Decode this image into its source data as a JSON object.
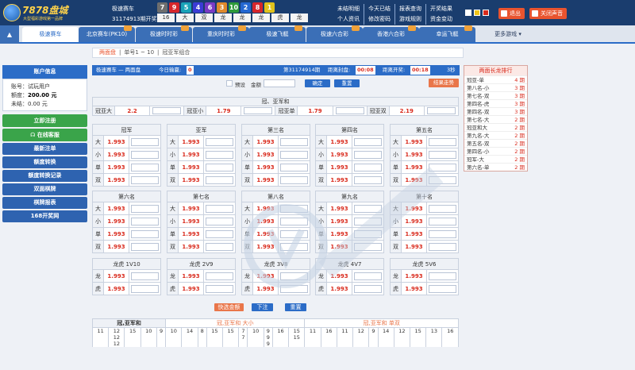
{
  "header": {
    "logo_name": "7878盘城",
    "logo_sub": "大型福彩游戏第一品牌",
    "game_name": "极速赛车",
    "period_text": "31174913期开奖",
    "balls": [
      {
        "n": "7",
        "c": "#6e6e6e"
      },
      {
        "n": "9",
        "c": "#d6262b"
      },
      {
        "n": "5",
        "c": "#1aa3b8"
      },
      {
        "n": "4",
        "c": "#3b3bd6"
      },
      {
        "n": "6",
        "c": "#7a3ac4"
      },
      {
        "n": "3",
        "c": "#e08a2c"
      },
      {
        "n": "10",
        "c": "#2e9a3a"
      },
      {
        "n": "2",
        "c": "#2468d2"
      },
      {
        "n": "8",
        "c": "#d6262b"
      },
      {
        "n": "1",
        "c": "#e0c21c"
      }
    ],
    "lhd": [
      "16",
      "大",
      "双",
      "龙",
      "龙",
      "龙",
      "虎",
      "龙"
    ],
    "links_row1": [
      "未结明细",
      "今天已结",
      "报表查询",
      "开奖结果"
    ],
    "links_row2": [
      "个人资讯",
      "修改密码",
      "游戏规则",
      "资金变动"
    ],
    "color_swatches": [
      "#ffffff",
      "#f0c419",
      "#d92a1c"
    ],
    "logout": "退出",
    "sound": "关闭声音"
  },
  "nav": {
    "tabs": [
      "极速赛车",
      "北京赛车(PK10)",
      "极速时时彩",
      "重庆时时彩",
      "极速飞艇",
      "极速六合彩",
      "香港六合彩",
      "幸运飞艇"
    ],
    "more": "更多游戏"
  },
  "sidebar": {
    "title": "账户信息",
    "account_label": "账号：",
    "account_value": "试玩用户",
    "credit_label": "额度：",
    "credit_value": "200.00 元",
    "unsettled_label": "未结：",
    "unsettled_value": "0.00 元",
    "register": "立即注册",
    "service": "在线客服",
    "menu": [
      "最新注单",
      "额度转换",
      "额度转换记录",
      "双面棋牌",
      "棋牌报表",
      "168开奖网"
    ]
  },
  "crumbs": {
    "active": "两面盘",
    "items": [
      "单号1 ~ 10",
      "冠亚军组合"
    ]
  },
  "bar": {
    "title": "极速赛车 — 两面盘",
    "profit_label": "今日输赢:",
    "profit_value": "0",
    "period": "第31174914期",
    "close_label": "距离封盘:",
    "close_time": "00:08",
    "draw_label": "距离开奖:",
    "draw_time": "00:18",
    "count": "3秒"
  },
  "tools": {
    "preset": "预设",
    "amount_label": "金额",
    "confirm": "确定",
    "reset": "重置",
    "trend": "结果走势"
  },
  "guan_ya": {
    "title": "冠、亚军和",
    "cells": [
      {
        "k": "冠亚大",
        "o": "2.2"
      },
      {
        "k": "冠亚小",
        "o": "1.79"
      },
      {
        "k": "冠亚单",
        "o": "1.79"
      },
      {
        "k": "冠亚双",
        "o": "2.19"
      }
    ]
  },
  "groups": [
    {
      "title": "冠军",
      "rows": [
        [
          "大",
          "1.993"
        ],
        [
          "小",
          "1.993"
        ],
        [
          "单",
          "1.993"
        ],
        [
          "双",
          "1.993"
        ]
      ]
    },
    {
      "title": "亚军",
      "rows": [
        [
          "大",
          "1.993"
        ],
        [
          "小",
          "1.993"
        ],
        [
          "单",
          "1.993"
        ],
        [
          "双",
          "1.993"
        ]
      ]
    },
    {
      "title": "第三名",
      "rows": [
        [
          "大",
          "1.993"
        ],
        [
          "小",
          "1.993"
        ],
        [
          "单",
          "1.993"
        ],
        [
          "双",
          "1.993"
        ]
      ]
    },
    {
      "title": "第四名",
      "rows": [
        [
          "大",
          "1.993"
        ],
        [
          "小",
          "1.993"
        ],
        [
          "单",
          "1.993"
        ],
        [
          "双",
          "1.993"
        ]
      ]
    },
    {
      "title": "第五名",
      "rows": [
        [
          "大",
          "1.993"
        ],
        [
          "小",
          "1.993"
        ],
        [
          "单",
          "1.993"
        ],
        [
          "双",
          "1.993"
        ]
      ]
    },
    {
      "title": "第六名",
      "rows": [
        [
          "大",
          "1.993"
        ],
        [
          "小",
          "1.993"
        ],
        [
          "单",
          "1.993"
        ],
        [
          "双",
          "1.993"
        ]
      ]
    },
    {
      "title": "第七名",
      "rows": [
        [
          "大",
          "1.993"
        ],
        [
          "小",
          "1.993"
        ],
        [
          "单",
          "1.993"
        ],
        [
          "双",
          "1.993"
        ]
      ]
    },
    {
      "title": "第八名",
      "rows": [
        [
          "大",
          "1.993"
        ],
        [
          "小",
          "1.993"
        ],
        [
          "单",
          "1.993"
        ],
        [
          "双",
          "1.993"
        ]
      ]
    },
    {
      "title": "第九名",
      "rows": [
        [
          "大",
          "1.993"
        ],
        [
          "小",
          "1.993"
        ],
        [
          "单",
          "1.993"
        ],
        [
          "双",
          "1.993"
        ]
      ]
    },
    {
      "title": "第十名",
      "rows": [
        [
          "大",
          "1.993"
        ],
        [
          "小",
          "1.993"
        ],
        [
          "单",
          "1.993"
        ],
        [
          "双",
          "1.993"
        ]
      ]
    },
    {
      "title": "龙虎 1V10",
      "rows": [
        [
          "龙",
          "1.993"
        ],
        [
          "虎",
          "1.993"
        ]
      ]
    },
    {
      "title": "龙虎 2V9",
      "rows": [
        [
          "龙",
          "1.993"
        ],
        [
          "虎",
          "1.993"
        ]
      ]
    },
    {
      "title": "龙虎 3V8",
      "rows": [
        [
          "龙",
          "1.993"
        ],
        [
          "虎",
          "1.993"
        ]
      ]
    },
    {
      "title": "龙虎 4V7",
      "rows": [
        [
          "龙",
          "1.993"
        ],
        [
          "虎",
          "1.993"
        ]
      ]
    },
    {
      "title": "龙虎 5V6",
      "rows": [
        [
          "龙",
          "1.993"
        ],
        [
          "虎",
          "1.993"
        ]
      ]
    }
  ],
  "bottom_buttons": {
    "quick": "快选金额",
    "submit": "下注",
    "reset": "重置"
  },
  "stats": {
    "tabs": [
      "冠,亚军和",
      "冠,亚军和 大小",
      "冠,亚军和 单双"
    ],
    "row1": [
      "11",
      "12",
      "15",
      "10",
      "9",
      "10",
      "14",
      "8",
      "15",
      "15",
      "7",
      "10",
      "9",
      "16",
      "15",
      "11",
      "16",
      "11",
      "12",
      "9",
      "14",
      "12",
      "15",
      "13",
      "16"
    ],
    "row2": [
      "",
      "12",
      "",
      "",
      "",
      "",
      "",
      "",
      "",
      "",
      "7",
      "",
      "9",
      "",
      "15",
      "",
      "",
      "",
      "",
      "",
      "",
      "",
      "",
      "",
      ""
    ],
    "row3": [
      "",
      "12",
      "",
      "",
      "",
      "",
      "",
      "",
      "",
      "",
      "",
      "",
      "9",
      "",
      "",
      "",
      "",
      "",
      "",
      "",
      "",
      "",
      "",
      "",
      ""
    ]
  },
  "rank": {
    "title": "两面长龙排行",
    "rows": [
      [
        "冠亚-单",
        "4 期"
      ],
      [
        "第八名-小",
        "3 期"
      ],
      [
        "第七名-双",
        "3 期"
      ],
      [
        "第四名-虎",
        "3 期"
      ],
      [
        "第四名-双",
        "3 期"
      ],
      [
        "第七名-大",
        "2 期"
      ],
      [
        "冠亚和大",
        "2 期"
      ],
      [
        "第九名-大",
        "2 期"
      ],
      [
        "第五名-双",
        "2 期"
      ],
      [
        "第四名-小",
        "2 期"
      ],
      [
        "冠军-大",
        "2 期"
      ],
      [
        "第六名-单",
        "2 期"
      ]
    ]
  }
}
